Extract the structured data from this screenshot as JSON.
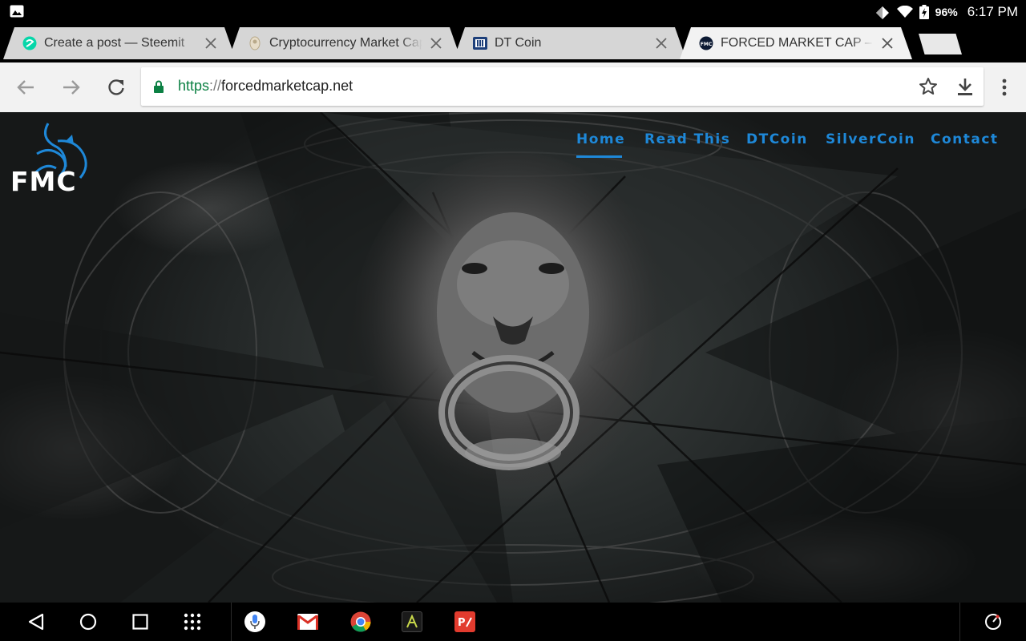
{
  "status_bar": {
    "battery_percent": "96%",
    "time": "6:17 PM"
  },
  "tabs": [
    {
      "title": "Create a post — Steemit",
      "favicon": "steemit-icon"
    },
    {
      "title": "Cryptocurrency Market Capitalizations",
      "favicon": "coinmarketcap-icon"
    },
    {
      "title": "DT Coin",
      "favicon": "dtcoin-icon"
    },
    {
      "title": "FORCED MARKET CAP – Bre",
      "favicon": "fmc-icon",
      "active": true
    }
  ],
  "omnibox": {
    "scheme": "https",
    "separator": "://",
    "host": "forcedmarketcap.net"
  },
  "site": {
    "brand": "FMC",
    "nav": [
      "Home",
      "Read This",
      "DTCoin",
      "SilverCoin",
      "Contact"
    ],
    "active_nav": "Home",
    "nav_color": "#1e88d8"
  },
  "taskbar_apps": [
    "google-voice-search-icon",
    "gmail-icon",
    "chrome-icon",
    "app-icon",
    "pdf-editor-icon"
  ]
}
